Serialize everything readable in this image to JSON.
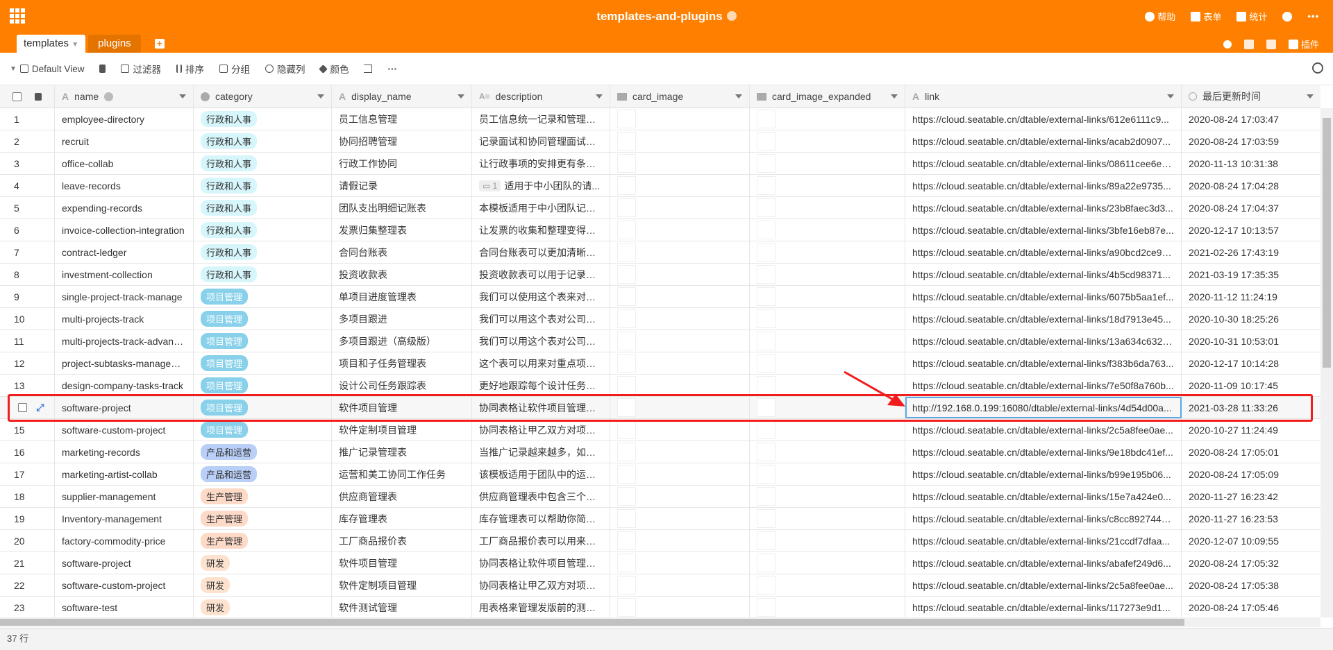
{
  "header": {
    "title": "templates-and-plugins",
    "help": "帮助",
    "form": "表单",
    "stats": "统计",
    "plugins": "插件",
    "tabs": [
      {
        "label": "templates"
      },
      {
        "label": "plugins"
      }
    ],
    "add_tab": "+"
  },
  "toolbar": {
    "view": "Default View",
    "filter": "过滤器",
    "sort": "排序",
    "group": "分组",
    "hide": "隐藏列",
    "color": "颜色",
    "more": "···"
  },
  "columns": [
    "name",
    "category",
    "display_name",
    "description",
    "card_image",
    "card_image_expanded",
    "link",
    "最后更新时间"
  ],
  "category_colors": {
    "行政和人事": [
      "#d7f6fb",
      "#333333"
    ],
    "项目管理": [
      "#89d1ea",
      "#ffffff"
    ],
    "产品和运营": [
      "#b9cff7",
      "#333333"
    ],
    "生产管理": [
      "#fdd9c7",
      "#333333"
    ],
    "研发": [
      "#fde3cf",
      "#333333"
    ]
  },
  "rows": [
    {
      "n": "1",
      "name": "employee-directory",
      "cat": "行政和人事",
      "disp": "员工信息管理",
      "desc": "员工信息统一记录和管理。 ...",
      "link": "https://cloud.seatable.cn/dtable/external-links/612e6111c9...",
      "time": "2020-08-24 17:03:47"
    },
    {
      "n": "2",
      "name": "recruit",
      "cat": "行政和人事",
      "disp": "协同招聘管理",
      "desc": "记录面试和协同管理面试。 ...",
      "link": "https://cloud.seatable.cn/dtable/external-links/acab2d0907...",
      "time": "2020-08-24 17:03:59"
    },
    {
      "n": "3",
      "name": "office-collab",
      "cat": "行政和人事",
      "disp": "行政工作协同",
      "desc": "让行政事项的安排更有条理...",
      "link": "https://cloud.seatable.cn/dtable/external-links/08611cee6e7...",
      "time": "2020-11-13 10:31:38"
    },
    {
      "n": "4",
      "name": "leave-records",
      "cat": "行政和人事",
      "disp": "请假记录",
      "desc": "适用于中小团队的请...",
      "badge": "1",
      "link": "https://cloud.seatable.cn/dtable/external-links/89a22e9735...",
      "time": "2020-08-24 17:04:28"
    },
    {
      "n": "5",
      "name": "expending-records",
      "cat": "行政和人事",
      "disp": "团队支出明细记账表",
      "desc": "本模板适用于中小团队记录...",
      "link": "https://cloud.seatable.cn/dtable/external-links/23b8faec3d3...",
      "time": "2020-08-24 17:04:37"
    },
    {
      "n": "6",
      "name": "invoice-collection-integration",
      "cat": "行政和人事",
      "disp": "发票归集整理表",
      "desc": "让发票的收集和整理变得更...",
      "link": "https://cloud.seatable.cn/dtable/external-links/3bfe16eb87e...",
      "time": "2020-12-17 10:13:57"
    },
    {
      "n": "7",
      "name": "contract-ledger",
      "cat": "行政和人事",
      "disp": "合同台账表",
      "desc": "合同台账表可以更加清晰地...",
      "link": "https://cloud.seatable.cn/dtable/external-links/a90bcd2ce93...",
      "time": "2021-02-26 17:43:19"
    },
    {
      "n": "8",
      "name": "investment-collection",
      "cat": "行政和人事",
      "disp": "投资收款表",
      "desc": "投资收款表可以用于记录借...",
      "link": "https://cloud.seatable.cn/dtable/external-links/4b5cd98371...",
      "time": "2021-03-19 17:35:35"
    },
    {
      "n": "9",
      "name": "single-project-track-manage",
      "cat": "项目管理",
      "disp": "单项目进度管理表",
      "desc": "我们可以使用这个表来对单...",
      "link": "https://cloud.seatable.cn/dtable/external-links/6075b5aa1ef...",
      "time": "2020-11-12 11:24:19"
    },
    {
      "n": "10",
      "name": "multi-projects-track",
      "cat": "项目管理",
      "disp": "多项目跟进",
      "desc": "我们可以用这个表对公司中...",
      "link": "https://cloud.seatable.cn/dtable/external-links/18d7913e45...",
      "time": "2020-10-30 18:25:26"
    },
    {
      "n": "11",
      "name": "multi-projects-track-advanc...",
      "cat": "项目管理",
      "disp": "多项目跟进（高级版）",
      "desc": "我们可以用这个表对公司中...",
      "link": "https://cloud.seatable.cn/dtable/external-links/13a634c6328...",
      "time": "2020-10-31 10:53:01"
    },
    {
      "n": "12",
      "name": "project-subtasks-managem...",
      "cat": "项目管理",
      "disp": "项目和子任务管理表",
      "desc": "这个表可以用来对重点项目...",
      "link": "https://cloud.seatable.cn/dtable/external-links/f383b6da763...",
      "time": "2020-12-17 10:14:28"
    },
    {
      "n": "13",
      "name": "design-company-tasks-track",
      "cat": "项目管理",
      "disp": "设计公司任务跟踪表",
      "desc": "更好地跟踪每个设计任务的...",
      "link": "https://cloud.seatable.cn/dtable/external-links/7e50f8a760b...",
      "time": "2020-11-09 10:17:45"
    },
    {
      "n": "",
      "name": "software-project",
      "cat": "项目管理",
      "disp": "软件项目管理",
      "desc": "协同表格让软件项目管理更...",
      "link": "http://192.168.0.199:16080/dtable/external-links/4d54d00a...",
      "time": "2021-03-28 11:33:26",
      "selected": true
    },
    {
      "n": "15",
      "name": "software-custom-project",
      "cat": "项目管理",
      "disp": "软件定制项目管理",
      "desc": "协同表格让甲乙双方对项目...",
      "link": "https://cloud.seatable.cn/dtable/external-links/2c5a8fee0ae...",
      "time": "2020-10-27 11:24:49"
    },
    {
      "n": "16",
      "name": "marketing-records",
      "cat": "产品和运营",
      "disp": "推广记录管理表",
      "desc": "当推广记录越来越多，如何...",
      "link": "https://cloud.seatable.cn/dtable/external-links/9e18bdc41ef...",
      "time": "2020-08-24 17:05:01"
    },
    {
      "n": "17",
      "name": "marketing-artist-collab",
      "cat": "产品和运营",
      "disp": "运营和美工协同工作任务",
      "desc": "该模板适用于团队中的运营...",
      "link": "https://cloud.seatable.cn/dtable/external-links/b99e195b06...",
      "time": "2020-08-24 17:05:09"
    },
    {
      "n": "18",
      "name": "supplier-management",
      "cat": "生产管理",
      "disp": "供应商管理表",
      "desc": "供应商管理表中包含三个子...",
      "link": "https://cloud.seatable.cn/dtable/external-links/15e7a424e0...",
      "time": "2020-11-27 16:23:42"
    },
    {
      "n": "19",
      "name": "Inventory-management",
      "cat": "生产管理",
      "disp": "库存管理表",
      "desc": "库存管理表可以帮助你简单...",
      "link": "https://cloud.seatable.cn/dtable/external-links/c8cc892744a...",
      "time": "2020-11-27 16:23:53"
    },
    {
      "n": "20",
      "name": "factory-commodity-price",
      "cat": "生产管理",
      "disp": "工厂商品报价表",
      "desc": "工厂商品报价表可以用来记...",
      "link": "https://cloud.seatable.cn/dtable/external-links/21ccdf7dfaa...",
      "time": "2020-12-07 10:09:55"
    },
    {
      "n": "21",
      "name": "software-project",
      "cat": "研发",
      "disp": "软件项目管理",
      "desc": "协同表格让软件项目管理更...",
      "link": "https://cloud.seatable.cn/dtable/external-links/abafef249d6...",
      "time": "2020-08-24 17:05:32"
    },
    {
      "n": "22",
      "name": "software-custom-project",
      "cat": "研发",
      "disp": "软件定制项目管理",
      "desc": "协同表格让甲乙双方对项目...",
      "link": "https://cloud.seatable.cn/dtable/external-links/2c5a8fee0ae...",
      "time": "2020-08-24 17:05:38"
    },
    {
      "n": "23",
      "name": "software-test",
      "cat": "研发",
      "disp": "软件测试管理",
      "desc": "用表格来管理发版前的测试...",
      "link": "https://cloud.seatable.cn/dtable/external-links/117273e9d1...",
      "time": "2020-08-24 17:05:46"
    }
  ],
  "footer": {
    "count": "37 行"
  }
}
